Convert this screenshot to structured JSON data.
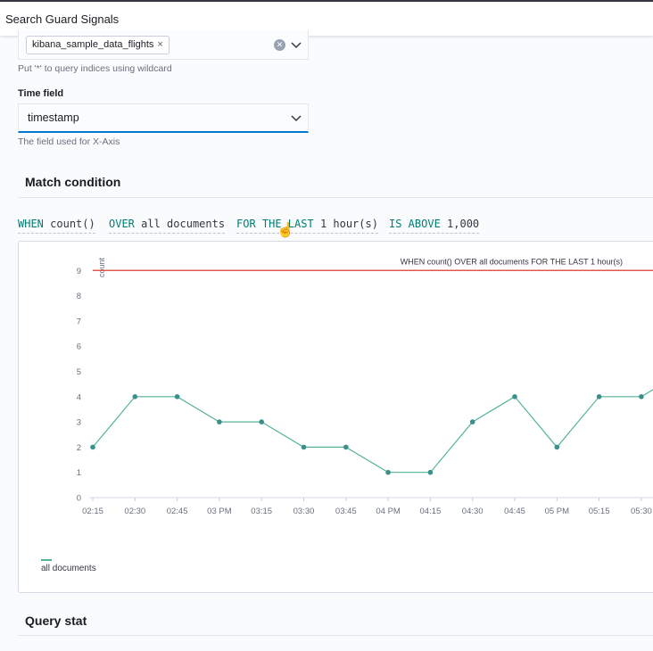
{
  "app": {
    "title": "Search Guard Signals"
  },
  "indices": {
    "selected": "kibana_sample_data_flights",
    "remove_glyph": "×",
    "clear_glyph": "✕",
    "help": "Put '*' to query indices using wildcard"
  },
  "time_field": {
    "label": "Time field",
    "value": "timestamp",
    "help": "The field used for X-Axis"
  },
  "match_condition": {
    "title": "Match condition",
    "when_kw": "WHEN",
    "when_val": "count()",
    "over_kw": "OVER",
    "over_val": "all documents",
    "for_kw": "FOR THE LAST",
    "for_val": "1 hour(s)",
    "is_kw": "IS ABOVE",
    "is_val": "1,000"
  },
  "query_stat": {
    "title": "Query stat"
  },
  "chart_data": {
    "type": "line",
    "ylabel": "count",
    "x": [
      "02:15",
      "02:30",
      "02:45",
      "03 PM",
      "03:15",
      "03:30",
      "03:45",
      "04 PM",
      "04:15",
      "04:30",
      "04:45",
      "05 PM",
      "05:15",
      "05:30"
    ],
    "series": [
      {
        "name": "all documents",
        "values": [
          2,
          4,
          4,
          3,
          3,
          2,
          2,
          1,
          1,
          3,
          4,
          2,
          4,
          4,
          5
        ]
      }
    ],
    "threshold": {
      "label": "WHEN count() OVER all documents FOR THE LAST 1 hour(s)",
      "value": 9
    },
    "ylim": [
      0,
      9
    ],
    "yticks": [
      0,
      1,
      2,
      3,
      4,
      5,
      6,
      7,
      8,
      9
    ],
    "grid": false,
    "legend": "bottom-left",
    "colors": {
      "series": "#54b399",
      "point": "#3a8f8a",
      "threshold": "#e0584f"
    }
  }
}
